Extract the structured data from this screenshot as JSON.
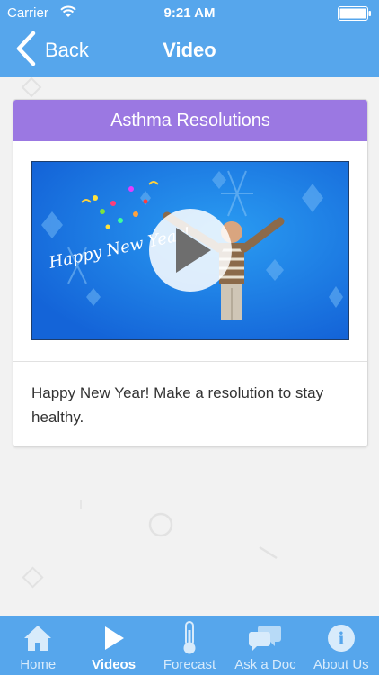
{
  "status_bar": {
    "carrier": "Carrier",
    "time": "9:21 AM"
  },
  "nav": {
    "back_label": "Back",
    "title": "Video"
  },
  "card": {
    "title": "Asthma Resolutions",
    "video_overlay_text": "Happy New Year!",
    "description": "Happy New Year! Make a resolution to stay healthy."
  },
  "tabs": [
    {
      "label": "Home",
      "icon": "house-icon",
      "active": false
    },
    {
      "label": "Videos",
      "icon": "play-icon",
      "active": true
    },
    {
      "label": "Forecast",
      "icon": "thermometer-icon",
      "active": false
    },
    {
      "label": "Ask a Doc",
      "icon": "chat-bubbles-icon",
      "active": false
    },
    {
      "label": "About Us",
      "icon": "info-icon",
      "active": false
    }
  ],
  "colors": {
    "bar_blue": "#56a6ec",
    "card_header_purple": "#9b78e2",
    "background": "#f2f2f2"
  }
}
